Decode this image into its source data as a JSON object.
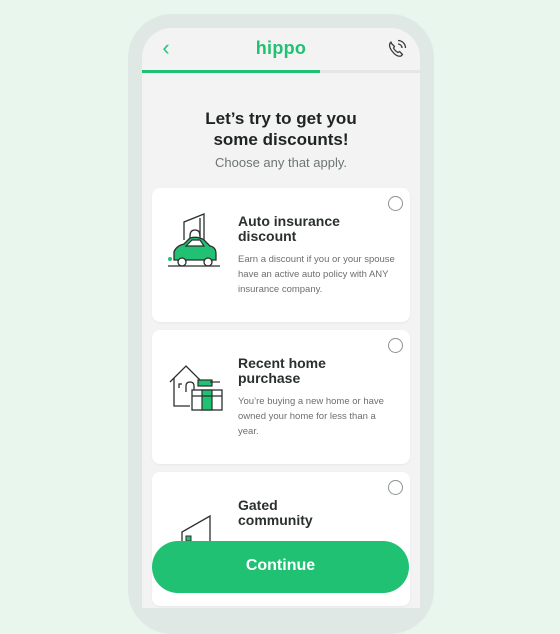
{
  "app": {
    "logo_text": "hippo",
    "accent": "#21c173"
  },
  "nav": {
    "back_icon": "chevron-left-icon",
    "call_icon": "phone-call-icon"
  },
  "progress": {
    "fraction": 0.64
  },
  "header": {
    "title_line1": "Let’s try to get you",
    "title_line2": "some discounts!",
    "subtitle": "Choose any that apply."
  },
  "discounts": [
    {
      "icon": "car-house-icon",
      "title_line1": "Auto insurance",
      "title_line2": "discount",
      "desc": "Earn a discount if you or your spouse have an active auto policy with ANY insurance company.",
      "selected": false
    },
    {
      "icon": "house-boxes-icon",
      "title_line1": "Recent home",
      "title_line2": "purchase",
      "desc": "You’re buying a new home or have owned your home for less than a year.",
      "selected": false
    },
    {
      "icon": "gate-icon",
      "title_line1": "Gated",
      "title_line2": "community",
      "desc": "",
      "selected": false
    }
  ],
  "footer": {
    "continue_label": "Continue"
  }
}
